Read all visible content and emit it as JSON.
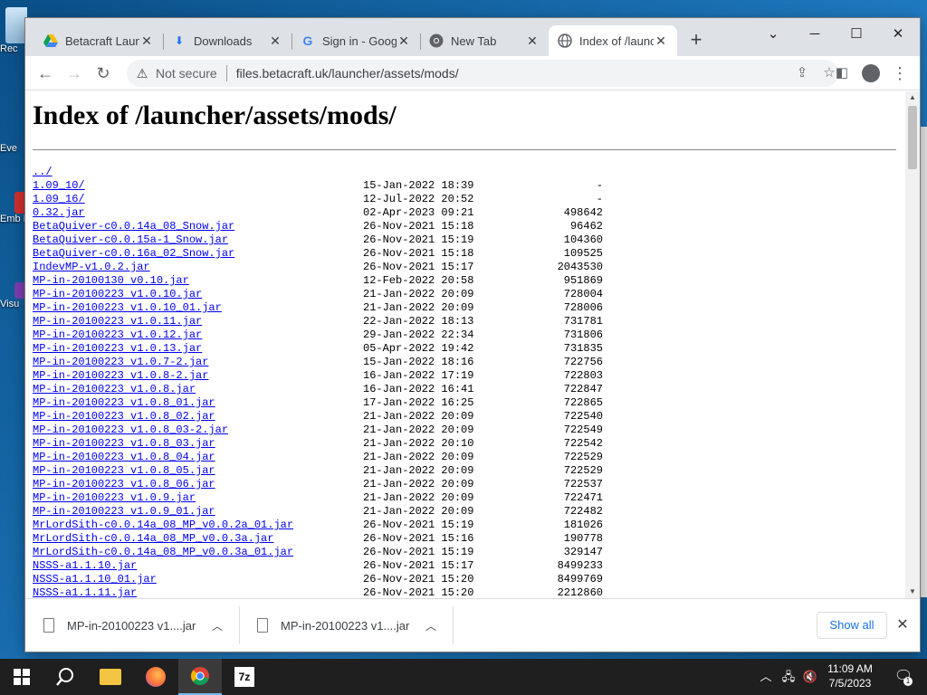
{
  "desktop": {
    "icons": [
      {
        "label": "Rec"
      },
      {
        "label": "Eve"
      },
      {
        "label": "Emb De"
      },
      {
        "label": "Visu"
      }
    ]
  },
  "browser": {
    "tabs": [
      {
        "title": "Betacraft Laun",
        "icon": "google-drive-icon",
        "active": false
      },
      {
        "title": "Downloads",
        "icon": "download-icon",
        "active": false
      },
      {
        "title": "Sign in - Goog",
        "icon": "google-icon",
        "active": false
      },
      {
        "title": "New Tab",
        "icon": "chrome-icon",
        "active": false
      },
      {
        "title": "Index of /launc",
        "icon": "globe-icon",
        "active": true
      }
    ],
    "address": {
      "security": "Not secure",
      "url": "files.betacraft.uk/launcher/assets/mods/"
    }
  },
  "page": {
    "heading": "Index of /launcher/assets/mods/",
    "entries": [
      {
        "name": "../",
        "date": "",
        "size": ""
      },
      {
        "name": "1.09_10/",
        "date": "15-Jan-2022 18:39",
        "size": "-"
      },
      {
        "name": "1.09_16/",
        "date": "12-Jul-2022 20:52",
        "size": "-"
      },
      {
        "name": "0.32.jar",
        "date": "02-Apr-2023 09:21",
        "size": "498642"
      },
      {
        "name": "BetaQuiver-c0.0.14a_08_Snow.jar",
        "date": "26-Nov-2021 15:18",
        "size": "96462"
      },
      {
        "name": "BetaQuiver-c0.0.15a-1_Snow.jar",
        "date": "26-Nov-2021 15:19",
        "size": "104360"
      },
      {
        "name": "BetaQuiver-c0.0.16a_02_Snow.jar",
        "date": "26-Nov-2021 15:18",
        "size": "109525"
      },
      {
        "name": "IndevMP-v1.0.2.jar",
        "date": "26-Nov-2021 15:17",
        "size": "2043530"
      },
      {
        "name": "MP-in-20100130 v0.10.jar",
        "date": "12-Feb-2022 20:58",
        "size": "951869"
      },
      {
        "name": "MP-in-20100223 v1.0.10.jar",
        "date": "21-Jan-2022 20:09",
        "size": "728004"
      },
      {
        "name": "MP-in-20100223 v1.0.10_01.jar",
        "date": "21-Jan-2022 20:09",
        "size": "728006"
      },
      {
        "name": "MP-in-20100223 v1.0.11.jar",
        "date": "22-Jan-2022 18:13",
        "size": "731781"
      },
      {
        "name": "MP-in-20100223 v1.0.12.jar",
        "date": "29-Jan-2022 22:34",
        "size": "731806"
      },
      {
        "name": "MP-in-20100223 v1.0.13.jar",
        "date": "05-Apr-2022 19:42",
        "size": "731835"
      },
      {
        "name": "MP-in-20100223 v1.0.7-2.jar",
        "date": "15-Jan-2022 18:16",
        "size": "722756"
      },
      {
        "name": "MP-in-20100223 v1.0.8-2.jar",
        "date": "16-Jan-2022 17:19",
        "size": "722803"
      },
      {
        "name": "MP-in-20100223 v1.0.8.jar",
        "date": "16-Jan-2022 16:41",
        "size": "722847"
      },
      {
        "name": "MP-in-20100223 v1.0.8_01.jar",
        "date": "17-Jan-2022 16:25",
        "size": "722865"
      },
      {
        "name": "MP-in-20100223 v1.0.8_02.jar",
        "date": "21-Jan-2022 20:09",
        "size": "722540"
      },
      {
        "name": "MP-in-20100223 v1.0.8_03-2.jar",
        "date": "21-Jan-2022 20:09",
        "size": "722549"
      },
      {
        "name": "MP-in-20100223 v1.0.8_03.jar",
        "date": "21-Jan-2022 20:10",
        "size": "722542"
      },
      {
        "name": "MP-in-20100223 v1.0.8_04.jar",
        "date": "21-Jan-2022 20:09",
        "size": "722529"
      },
      {
        "name": "MP-in-20100223 v1.0.8_05.jar",
        "date": "21-Jan-2022 20:09",
        "size": "722529"
      },
      {
        "name": "MP-in-20100223 v1.0.8_06.jar",
        "date": "21-Jan-2022 20:09",
        "size": "722537"
      },
      {
        "name": "MP-in-20100223 v1.0.9.jar",
        "date": "21-Jan-2022 20:09",
        "size": "722471"
      },
      {
        "name": "MP-in-20100223 v1.0.9_01.jar",
        "date": "21-Jan-2022 20:09",
        "size": "722482"
      },
      {
        "name": "MrLordSith-c0.0.14a_08_MP_v0.0.2a_01.jar",
        "date": "26-Nov-2021 15:19",
        "size": "181026"
      },
      {
        "name": "MrLordSith-c0.0.14a_08_MP_v0.0.3a.jar",
        "date": "26-Nov-2021 15:16",
        "size": "190778"
      },
      {
        "name": "MrLordSith-c0.0.14a_08_MP_v0.0.3a_01.jar",
        "date": "26-Nov-2021 15:19",
        "size": "329147"
      },
      {
        "name": "NSSS-a1.1.10.jar",
        "date": "26-Nov-2021 15:17",
        "size": "8499233"
      },
      {
        "name": "NSSS-a1.1.10_01.jar",
        "date": "26-Nov-2021 15:20",
        "size": "8499769"
      },
      {
        "name": "NSSS-a1.1.11.jar",
        "date": "26-Nov-2021 15:20",
        "size": "2212860"
      }
    ]
  },
  "downloads": {
    "items": [
      {
        "name": "MP-in-20100223 v1....jar"
      },
      {
        "name": "MP-in-20100223 v1....jar"
      }
    ],
    "show_all": "Show all"
  },
  "taskbar": {
    "time": "11:09 AM",
    "date": "7/5/2023",
    "notification_count": "1"
  }
}
